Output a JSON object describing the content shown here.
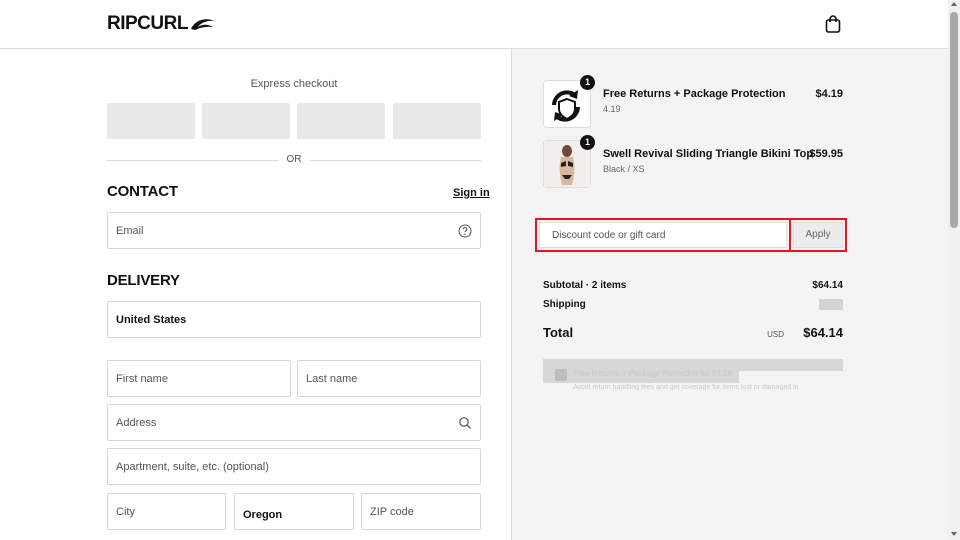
{
  "header": {
    "brand": "RIPCURL",
    "cart_icon": "shopping-bag-icon"
  },
  "express": {
    "label": "Express checkout",
    "or_text": "OR"
  },
  "contact": {
    "title": "CONTACT",
    "sign_in_label": "Sign in",
    "email_placeholder": "Email",
    "help_icon": "question-circle-icon"
  },
  "delivery": {
    "title": "DELIVERY",
    "country_value": "United States",
    "first_name_placeholder": "First name",
    "last_name_placeholder": "Last name",
    "address_placeholder": "Address",
    "address_icon": "search-icon",
    "apartment_placeholder": "Apartment, suite, etc. (optional)",
    "city_placeholder": "City",
    "state_value": "Oregon",
    "zip_placeholder": "ZIP code"
  },
  "cart": {
    "items": [
      {
        "name": "Free Returns + Package Protection",
        "subtitle": "4.19",
        "price": "$4.19",
        "quantity": "1",
        "thumb_icon": "shield-refresh-icon"
      },
      {
        "name": "Swell Revival Sliding Triangle Bikini Top",
        "subtitle": "Black / XS",
        "price": "$59.95",
        "quantity": "1",
        "thumb_icon": "bikini-product-image"
      }
    ]
  },
  "discount": {
    "placeholder": "Discount code or gift card",
    "apply_label": "Apply",
    "highlight_color": "#d91c24"
  },
  "summary": {
    "subtotal_label": "Subtotal · 2 items",
    "subtotal_value": "$64.14",
    "shipping_label": "Shipping",
    "total_label": "Total",
    "currency": "USD",
    "total_value": "$64.14"
  },
  "protection": {
    "label": "Free Returns + Package Protection for $4.19",
    "description": "Avoid return handling fees and get coverage for items lost or damaged in"
  }
}
